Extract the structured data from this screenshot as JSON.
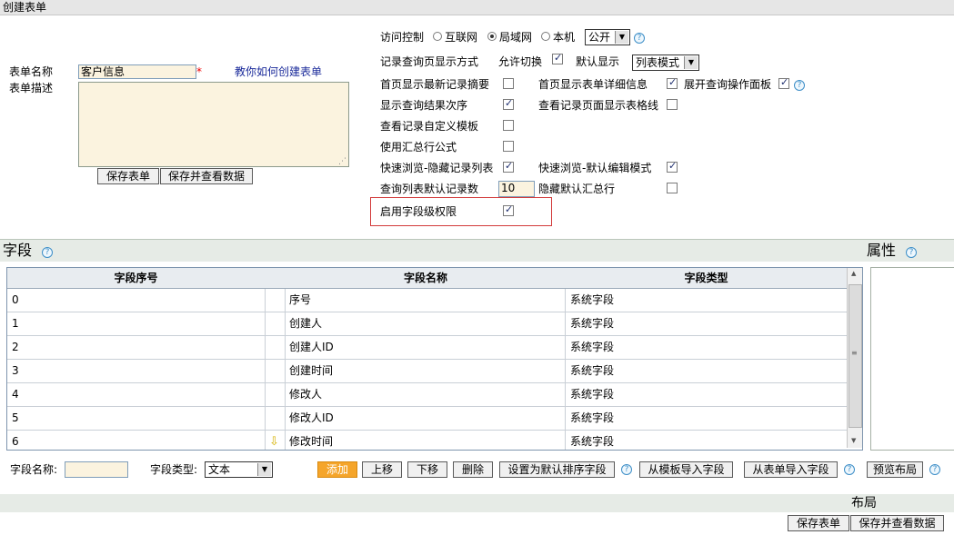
{
  "title": "创建表单",
  "form": {
    "name_label": "表单名称",
    "name_value": "客户信息",
    "required_mark": "*",
    "help_link": "教你如何创建表单",
    "desc_label": "表单描述",
    "save_btn": "保存表单",
    "save_view_btn": "保存并查看数据"
  },
  "settings": {
    "access_label": "访问控制",
    "access_options": [
      "互联网",
      "局域网",
      "本机"
    ],
    "access_selected": "局域网",
    "visibility_value": "公开",
    "display_label": "记录查询页显示方式",
    "allow_switch_label": "允许切换",
    "allow_switch_checked": true,
    "default_display_label": "默认显示",
    "default_display_value": "列表模式",
    "rows": [
      {
        "left": "首页显示最新记录摘要",
        "left_checked": false,
        "right": "首页显示表单详细信息",
        "right_checked": true,
        "extra": "展开查询操作面板",
        "extra_checked": true
      },
      {
        "left": "显示查询结果次序",
        "left_checked": true,
        "right": "查看记录页面显示表格线",
        "right_checked": false
      },
      {
        "left": "查看记录自定义模板",
        "left_checked": false
      },
      {
        "left": "使用汇总行公式",
        "left_checked": false
      },
      {
        "left": "快速浏览-隐藏记录列表",
        "left_checked": true,
        "right": "快速浏览-默认编辑模式",
        "right_checked": true
      },
      {
        "left": "查询列表默认记录数",
        "left_value": "10",
        "right": "隐藏默认汇总行",
        "right_checked": false
      }
    ],
    "field_perm_label": "启用字段级权限",
    "field_perm_checked": true
  },
  "fields_section": {
    "title": "字段",
    "props_title": "属性",
    "columns": [
      "字段序号",
      "字段名称",
      "字段类型"
    ],
    "rows": [
      {
        "id": "0",
        "name": "序号",
        "type": "系统字段"
      },
      {
        "id": "1",
        "name": "创建人",
        "type": "系统字段"
      },
      {
        "id": "2",
        "name": "创建人ID",
        "type": "系统字段"
      },
      {
        "id": "3",
        "name": "创建时间",
        "type": "系统字段"
      },
      {
        "id": "4",
        "name": "修改人",
        "type": "系统字段"
      },
      {
        "id": "5",
        "name": "修改人ID",
        "type": "系统字段"
      },
      {
        "id": "6",
        "name": "修改时间",
        "type": "系统字段"
      }
    ]
  },
  "field_editor": {
    "name_label": "字段名称:",
    "type_label": "字段类型:",
    "type_value": "文本",
    "buttons": [
      "添加",
      "上移",
      "下移",
      "删除",
      "设置为默认排序字段",
      "从模板导入字段",
      "从表单导入字段",
      "预览布局"
    ]
  },
  "layout": {
    "title": "布局",
    "save_btn": "保存表单",
    "save_view_btn": "保存并查看数据"
  }
}
